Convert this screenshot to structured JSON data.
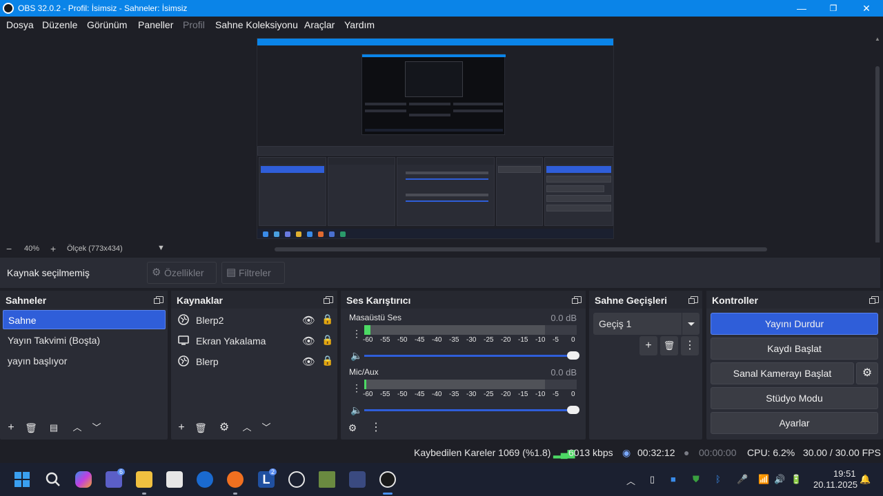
{
  "window": {
    "title": "OBS 32.0.2 - Profil: İsimsiz - Sahneler: İsimsiz"
  },
  "menu": [
    "Dosya",
    "Düzenle",
    "Görünüm",
    "Paneller",
    "Profil",
    "Sahne Koleksiyonu",
    "Araçlar",
    "Yardım"
  ],
  "zoom": {
    "minus": "−",
    "value": "40%",
    "plus": "+",
    "scale": "Ölçek (773x434)"
  },
  "source_bar": {
    "label": "Kaynak seçilmemiş",
    "properties": "Özellikler",
    "filters": "Filtreler"
  },
  "scenes": {
    "title": "Sahneler",
    "items": [
      "Sahne",
      "Yayın Takvimi (Boşta)",
      "yayın başlıyor"
    ],
    "selected": 0
  },
  "sources": {
    "title": "Kaynaklar",
    "items": [
      {
        "name": "Blerp2",
        "icon": "browser-icon"
      },
      {
        "name": "Ekran Yakalama",
        "icon": "monitor-icon"
      },
      {
        "name": "Blerp",
        "icon": "browser-icon"
      }
    ]
  },
  "mixer": {
    "title": "Ses Karıştırıcı",
    "channels": [
      {
        "name": "Masaüstü Ses",
        "db": "0.0 dB",
        "level": 0.03
      },
      {
        "name": "Mic/Aux",
        "db": "0.0 dB",
        "level": 0.01
      }
    ],
    "ticks": [
      "-60",
      "-55",
      "-50",
      "-45",
      "-40",
      "-35",
      "-30",
      "-25",
      "-20",
      "-15",
      "-10",
      "-5",
      "0"
    ]
  },
  "transitions": {
    "title": "Sahne Geçişleri",
    "selected": "Geçiş 1"
  },
  "controls": {
    "title": "Kontroller",
    "buttons": [
      "Yayını Durdur",
      "Kaydı Başlat",
      "Sanal Kamerayı Başlat",
      "Stüdyo Modu",
      "Ayarlar"
    ]
  },
  "status": {
    "dropped": "Kaybedilen Kareler 1069 (%1.8)",
    "kbps": "6013 kbps",
    "stream_time": "00:32:12",
    "rec_time": "00:00:00",
    "cpu": "CPU: 6.2%",
    "fps": "30.00 / 30.00 FPS"
  },
  "taskbar": {
    "time": "19:51",
    "date": "20.11.2025",
    "teams_badge": "6",
    "l_badge": "2"
  },
  "colors": {
    "accent": "#2f5ed9",
    "titlebar": "#0a84e8",
    "panel": "#2a2c35",
    "bg": "#1e1f26"
  }
}
